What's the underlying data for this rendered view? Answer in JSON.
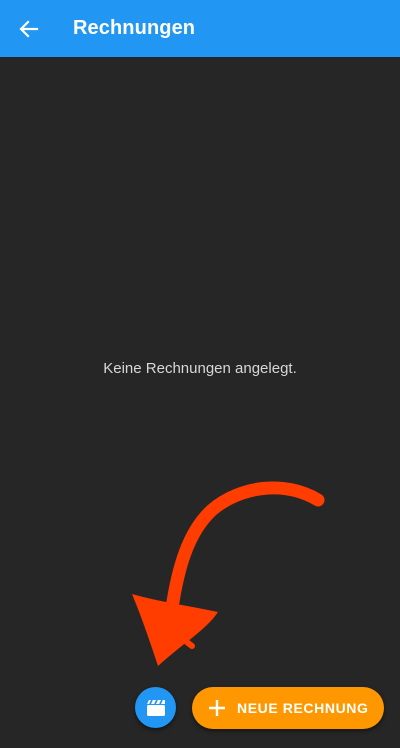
{
  "appbar": {
    "title": "Rechnungen",
    "back_icon": "arrow-left-icon",
    "color": "#2196f3"
  },
  "main": {
    "empty_message": "Keine Rechnungen angelegt."
  },
  "annotation": {
    "icon": "hand-drawn-arrow",
    "color": "#ff3d00"
  },
  "actions": {
    "video_icon": "clapperboard-icon",
    "new_invoice_label": "NEUE RECHNUNG",
    "new_invoice_icon": "plus-icon",
    "accent": "#ff9800"
  },
  "colors": {
    "background": "#262626"
  }
}
